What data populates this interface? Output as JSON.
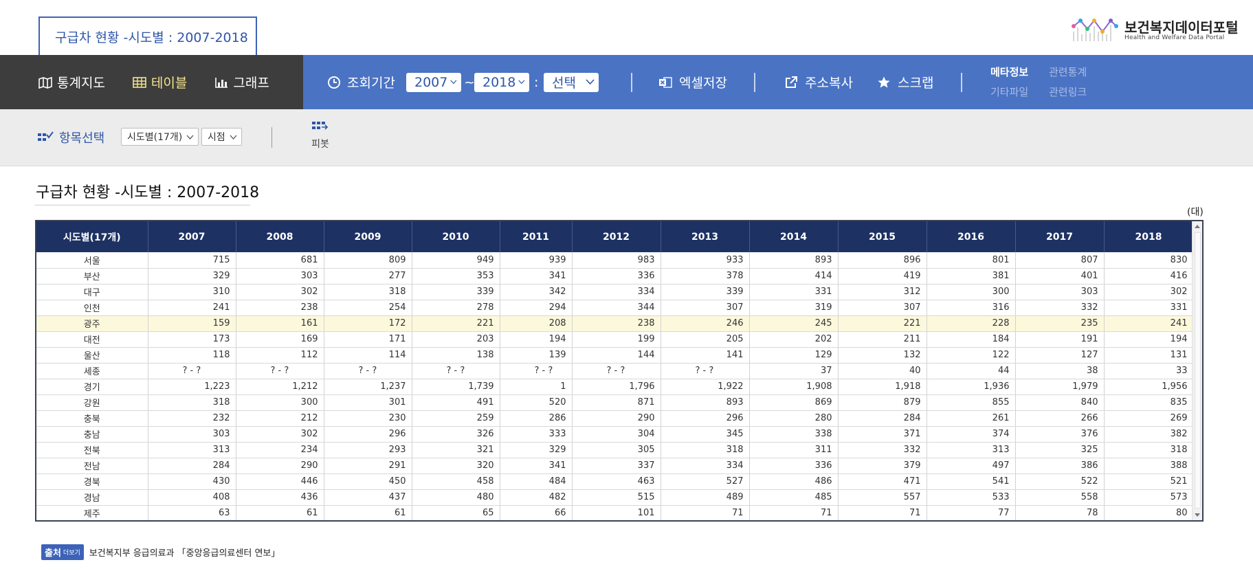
{
  "title_tab": "구급차 현황 -시도별 : 2007-2018",
  "logo": {
    "name": "보건복지데이터포털",
    "subtitle": "Health and Welfare Data Portal"
  },
  "views": [
    {
      "label": "통계지도",
      "icon": "map-icon"
    },
    {
      "label": "테이블",
      "icon": "table-icon",
      "active": true
    },
    {
      "label": "그래프",
      "icon": "bar-chart-icon"
    }
  ],
  "toolbar": {
    "period_label": "조회기간",
    "start_year": "2007",
    "tilde": "~",
    "end_year": "2018",
    "colon": ":",
    "select_label": "선택",
    "excel_label": "엑셀저장",
    "copy_url_label": "주소복사",
    "scrap_label": "스크랩",
    "meta_info": "메타정보",
    "related_stats": "관련통계",
    "other_files": "기타파일",
    "related_links": "관련링크"
  },
  "options": {
    "title": "항목선택",
    "dropdown1": "시도별(17개)",
    "dropdown2": "시점",
    "pivot_label": "피봇"
  },
  "page_title": "구급차 현황 -시도별 : 2007-2018",
  "unit": "(대)",
  "table": {
    "header_first": "시도별(17개)",
    "years": [
      "2007",
      "2008",
      "2009",
      "2010",
      "2011",
      "2012",
      "2013",
      "2014",
      "2015",
      "2016",
      "2017",
      "2018"
    ],
    "rows": [
      {
        "region": "서울",
        "values": [
          "715",
          "681",
          "809",
          "949",
          "939",
          "983",
          "933",
          "893",
          "896",
          "801",
          "807",
          "830"
        ]
      },
      {
        "region": "부산",
        "values": [
          "329",
          "303",
          "277",
          "353",
          "341",
          "336",
          "378",
          "414",
          "419",
          "381",
          "401",
          "416"
        ]
      },
      {
        "region": "대구",
        "values": [
          "310",
          "302",
          "318",
          "339",
          "342",
          "334",
          "339",
          "331",
          "312",
          "300",
          "303",
          "302"
        ]
      },
      {
        "region": "인천",
        "values": [
          "241",
          "238",
          "254",
          "278",
          "294",
          "344",
          "307",
          "319",
          "307",
          "316",
          "332",
          "331"
        ]
      },
      {
        "region": "광주",
        "values": [
          "159",
          "161",
          "172",
          "221",
          "208",
          "238",
          "246",
          "245",
          "221",
          "228",
          "235",
          "241"
        ],
        "highlight": true
      },
      {
        "region": "대전",
        "values": [
          "173",
          "169",
          "171",
          "203",
          "194",
          "199",
          "205",
          "202",
          "211",
          "184",
          "191",
          "194"
        ]
      },
      {
        "region": "울산",
        "values": [
          "118",
          "112",
          "114",
          "138",
          "139",
          "144",
          "141",
          "129",
          "132",
          "122",
          "127",
          "131"
        ]
      },
      {
        "region": "세종",
        "values": [
          "? - ?",
          "? - ?",
          "? - ?",
          "? - ?",
          "? - ?",
          "? - ?",
          "? - ?",
          "37",
          "40",
          "44",
          "38",
          "33"
        ]
      },
      {
        "region": "경기",
        "values": [
          "1,223",
          "1,212",
          "1,237",
          "1,739",
          "1",
          "1,796",
          "1,922",
          "1,908",
          "1,918",
          "1,936",
          "1,979",
          "1,956"
        ]
      },
      {
        "region": "강원",
        "values": [
          "318",
          "300",
          "301",
          "491",
          "520",
          "871",
          "893",
          "869",
          "879",
          "855",
          "840",
          "835"
        ]
      },
      {
        "region": "충북",
        "values": [
          "232",
          "212",
          "230",
          "259",
          "286",
          "290",
          "296",
          "280",
          "284",
          "261",
          "266",
          "269"
        ]
      },
      {
        "region": "충남",
        "values": [
          "303",
          "302",
          "296",
          "326",
          "333",
          "304",
          "345",
          "338",
          "371",
          "374",
          "376",
          "382"
        ]
      },
      {
        "region": "전북",
        "values": [
          "313",
          "234",
          "293",
          "321",
          "329",
          "305",
          "318",
          "311",
          "332",
          "313",
          "325",
          "318"
        ]
      },
      {
        "region": "전남",
        "values": [
          "284",
          "290",
          "291",
          "320",
          "341",
          "337",
          "334",
          "336",
          "379",
          "497",
          "386",
          "388"
        ]
      },
      {
        "region": "경북",
        "values": [
          "430",
          "446",
          "450",
          "458",
          "484",
          "463",
          "527",
          "486",
          "471",
          "541",
          "522",
          "521"
        ]
      },
      {
        "region": "경남",
        "values": [
          "408",
          "436",
          "437",
          "480",
          "482",
          "515",
          "489",
          "485",
          "557",
          "533",
          "558",
          "573"
        ]
      },
      {
        "region": "제주",
        "values": [
          "63",
          "61",
          "61",
          "65",
          "66",
          "101",
          "71",
          "71",
          "71",
          "77",
          "78",
          "80"
        ]
      }
    ]
  },
  "source": {
    "badge": "출처",
    "more": "더보기",
    "text": "보건복지부 응급의료과 「중앙응급의료센터 연보」"
  }
}
